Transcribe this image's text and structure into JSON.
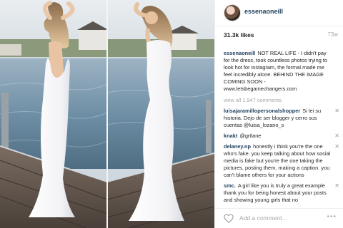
{
  "post": {
    "username": "essenaoneill",
    "likes": "31.3k likes",
    "time_ago": "73w"
  },
  "caption": {
    "user": "essenaoneill",
    "text": "NOT REAL LIFE - I didn't pay for the dress, took countless photos trying to look hot for instagram, the formal made me feel incredibly alone. BEHIND THE IMAGE COMING SOON - www.letsbegamechangers.com"
  },
  "view_all": "view all 1,947 comments",
  "comments": [
    {
      "user": "luisajaramillopersonalshopper",
      "text": "Si lei su historia. Dejo de ser blogger y cerro sus cuentas @luisa_lozano_s"
    },
    {
      "user": "knakt",
      "text": "@grtlane"
    },
    {
      "user": "delaney.np",
      "text": "honestly i think you're the one who's fake. you keep talking about how social media is fake but you're the one taking the pictures, posting them, making a caption. you can't blame others for your actions"
    },
    {
      "user": "smc.",
      "text": "A girl like you is truly a great example thank you for being honest about your posts and showing young girls that no"
    }
  ],
  "comment_box": {
    "placeholder": "Add a comment..."
  },
  "icons": {
    "heart": "heart-icon",
    "close": "close-icon",
    "more": "more-options-icon"
  },
  "colors": {
    "username_blue": "#1d3e5e",
    "muted_gray": "#a5a7aa",
    "dress_white": "#f4f4f6",
    "water": "#6f8fa6"
  }
}
